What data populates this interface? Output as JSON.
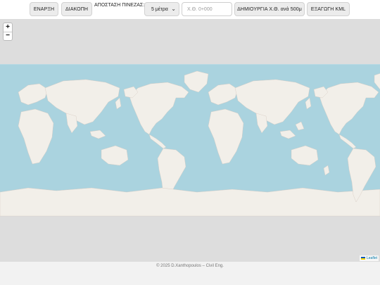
{
  "toolbar": {
    "start_label": "ΕΝΑΡΞΗ",
    "stop_label": "ΔΙΑΚΟΠΗ",
    "distance_label": "ΑΠΟΣΤΑΣΗ ΠΙΝΕΖΑΣ:",
    "distance_value": "5 μέτρα",
    "chainage_placeholder": "Χ.Θ. 0+000",
    "create_label": "ΔΗΜΙΟΥΡΓΙΑ Χ.Θ. ανά 500μ",
    "export_label": "ΕΞΑΓΩΓΗ KML"
  },
  "map": {
    "zoom_in": "+",
    "zoom_out": "−",
    "attribution": "Leaflet",
    "ocean_color": "#aad3df",
    "land_color": "#f2efe9",
    "ice_color": "#f4f3ee"
  },
  "footer": {
    "text": "© 2025 D.Xanthopoulos – Civil Eng."
  }
}
